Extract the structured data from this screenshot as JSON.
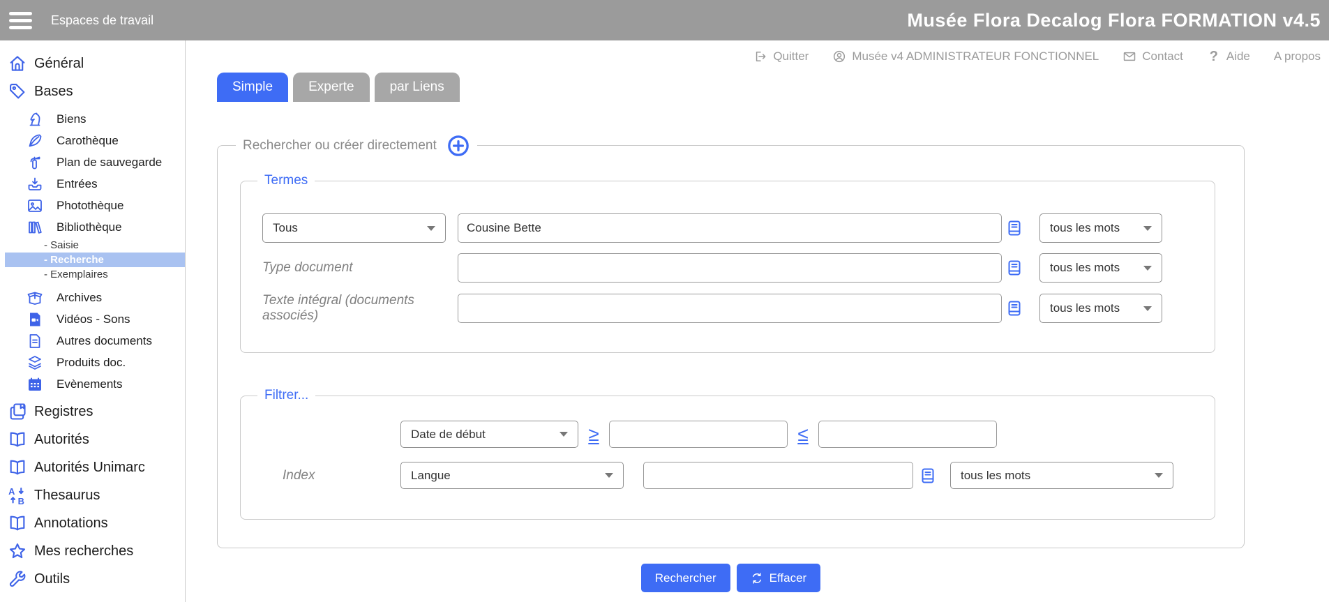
{
  "header": {
    "workspace_label": "Espaces de travail",
    "app_title": "Musée Flora Decalog Flora FORMATION v4.5"
  },
  "utility_bar": {
    "items": [
      {
        "icon": "logout",
        "label": "Quitter"
      },
      {
        "icon": "user",
        "label": "Musée v4 ADMINISTRATEUR FONCTIONNEL"
      },
      {
        "icon": "mail",
        "label": "Contact"
      },
      {
        "icon": "help",
        "label": "Aide"
      },
      {
        "icon": "",
        "label": "A propos"
      }
    ]
  },
  "sidebar": {
    "items": [
      {
        "label": "Général",
        "icon": "home",
        "level": 0
      },
      {
        "label": "Bases",
        "icon": "tag",
        "level": 0
      },
      {
        "label": "Biens",
        "icon": "knight",
        "level": 1,
        "gap": 4
      },
      {
        "label": "Carothèque",
        "icon": "quill",
        "level": 1
      },
      {
        "label": "Plan de sauvegarde",
        "icon": "extinguisher",
        "level": 1
      },
      {
        "label": "Entrées",
        "icon": "inbox-down",
        "level": 1
      },
      {
        "label": "Photothèque",
        "icon": "image",
        "level": 1
      },
      {
        "label": "Bibliothèque",
        "icon": "books",
        "level": 1
      },
      {
        "label": "- Saisie",
        "level": 2
      },
      {
        "label": "- Recherche",
        "level": 2,
        "active": true
      },
      {
        "label": "- Exemplaires",
        "level": 2
      },
      {
        "label": "Archives",
        "icon": "box-open",
        "level": 1,
        "gap": 7
      },
      {
        "label": "Vidéos - Sons",
        "icon": "video-file",
        "level": 1
      },
      {
        "label": "Autres documents",
        "icon": "doc-file",
        "level": 1
      },
      {
        "label": "Produits doc.",
        "icon": "stack",
        "level": 1
      },
      {
        "label": "Evènements",
        "icon": "calendar",
        "level": 1
      },
      {
        "label": "Registres",
        "icon": "registers",
        "level": 0,
        "gap": 4
      },
      {
        "label": "Autorités",
        "icon": "open-book",
        "level": 0
      },
      {
        "label": "Autorités Unimarc",
        "icon": "open-book",
        "level": 0
      },
      {
        "label": "Thesaurus",
        "icon": "sort-alpha",
        "level": 0
      },
      {
        "label": "Annotations",
        "icon": "open-book",
        "level": 0
      },
      {
        "label": "Mes recherches",
        "icon": "star",
        "level": 0
      },
      {
        "label": "Outils",
        "icon": "wrench",
        "level": 0
      }
    ]
  },
  "tabs": [
    {
      "label": "Simple",
      "active": true
    },
    {
      "label": "Experte",
      "active": false
    },
    {
      "label": "par Liens",
      "active": false
    }
  ],
  "search_form": {
    "legend": "Rechercher ou créer directement",
    "termes": {
      "legend": "Termes",
      "rows": [
        {
          "field": "Tous",
          "value": "Cousine Bette",
          "mode": "tous les mots"
        },
        {
          "label": "Type document",
          "value": "",
          "mode": "tous les mots"
        },
        {
          "label": "Texte intégral (documents associés)",
          "value": "",
          "mode": "tous les mots"
        }
      ]
    },
    "filtrer": {
      "legend": "Filtrer...",
      "date_row": {
        "field": "Date de début",
        "gte": "≥",
        "from": "",
        "lte": "≤",
        "to": ""
      },
      "index_row": {
        "label": "Index",
        "field": "Langue",
        "value": "",
        "mode": "tous les mots"
      }
    }
  },
  "actions": {
    "search_label": "Rechercher",
    "clear_label": "Effacer"
  },
  "colors": {
    "accent": "#3e6cf5",
    "header_gray": "#9b9b9b",
    "inactive_tab": "#a7a7a7",
    "active_sidebar_item_bg": "#a9c2f1",
    "icon_blue": "#3e63e8"
  }
}
